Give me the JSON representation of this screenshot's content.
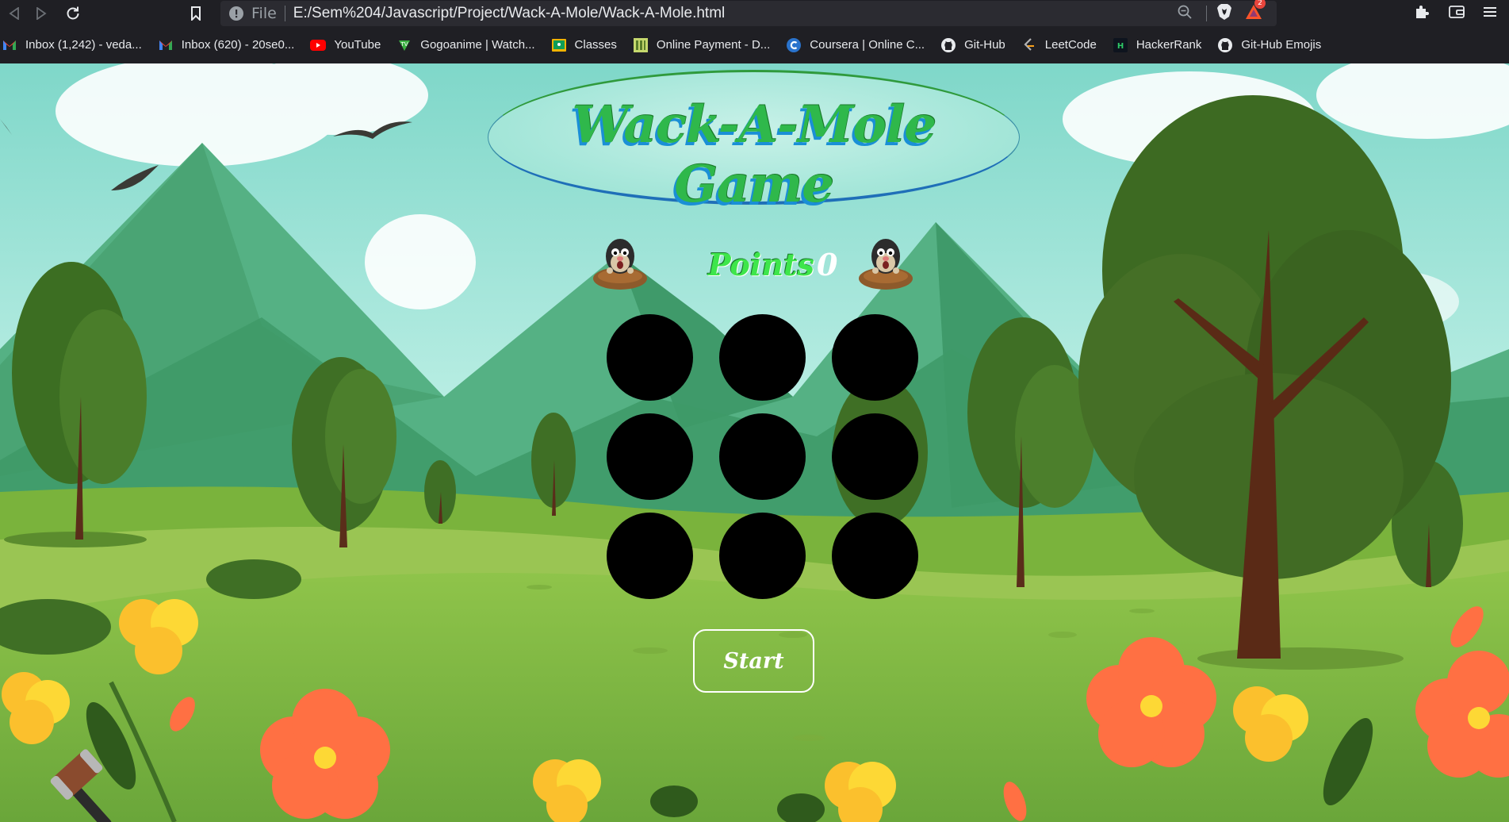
{
  "browser": {
    "address_scheme": "File",
    "address_url": "E:/Sem%204/Javascript/Project/Wack-A-Mole/Wack-A-Mole.html",
    "notification_count": "2"
  },
  "bookmarks": [
    {
      "label": "Inbox (1,242) - veda...",
      "icon": "gmail-icon"
    },
    {
      "label": "Inbox (620) - 20se0...",
      "icon": "gmail-icon"
    },
    {
      "label": "YouTube",
      "icon": "youtube-icon"
    },
    {
      "label": "Gogoanime | Watch...",
      "icon": "gogoanime-icon"
    },
    {
      "label": "Classes",
      "icon": "classroom-icon"
    },
    {
      "label": "Online Payment - D...",
      "icon": "payment-icon"
    },
    {
      "label": "Coursera | Online C...",
      "icon": "coursera-icon"
    },
    {
      "label": "Git-Hub",
      "icon": "github-icon"
    },
    {
      "label": "LeetCode",
      "icon": "leetcode-icon"
    },
    {
      "label": "HackerRank",
      "icon": "hackerrank-icon"
    },
    {
      "label": "Git-Hub Emojis",
      "icon": "github-icon"
    }
  ],
  "game": {
    "title": "Wack-A-Mole Game",
    "points_label": "Points",
    "points_value": "0",
    "holes": 9,
    "start_label": "Start"
  },
  "colors": {
    "title_green": "#2fb84b",
    "title_shadow_blue": "#1a8fd6",
    "points_green": "#3ee64b",
    "hole": "#000000"
  }
}
